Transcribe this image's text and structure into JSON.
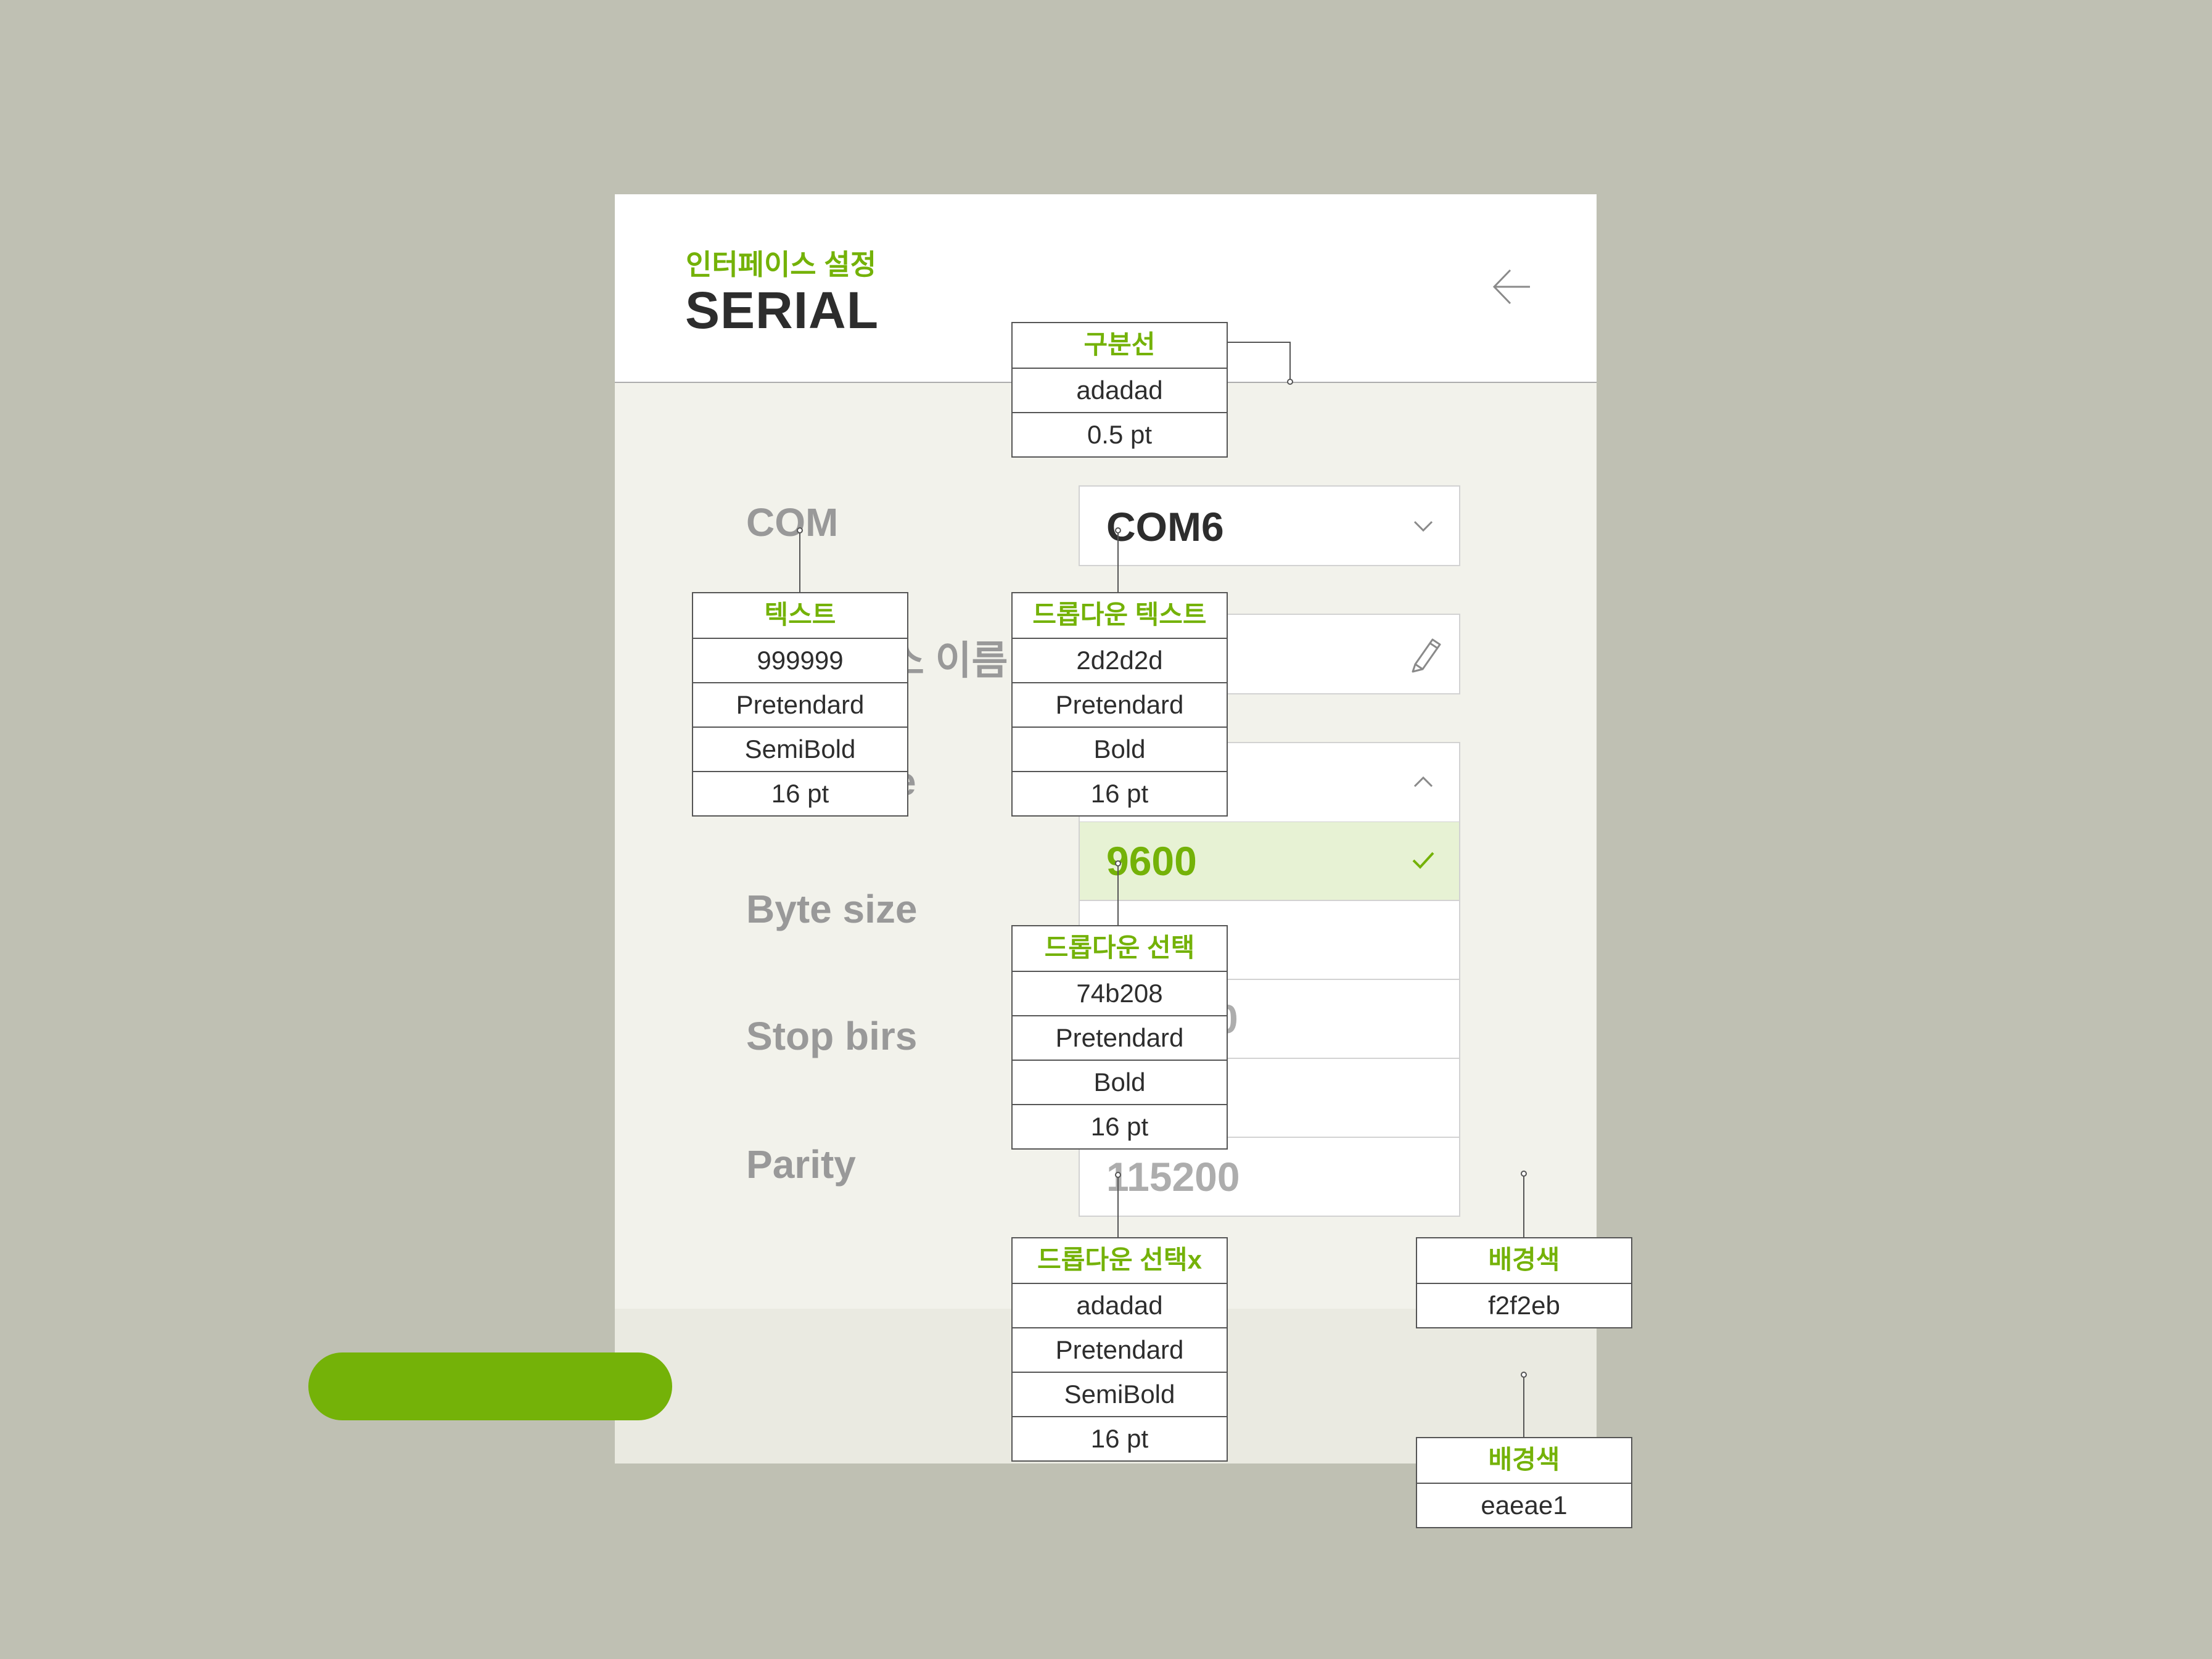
{
  "header": {
    "subtitle": "인터페이스 설정",
    "title": "SERIAL",
    "back_icon": "arrow-left-icon"
  },
  "form": {
    "rows": [
      {
        "label": "COM",
        "value": "COM6",
        "icon": "chevron-down-icon"
      },
      {
        "label": "소 이름",
        "icon": "pencil-icon"
      },
      {
        "label": "e",
        "icon": "chevron-up-icon"
      },
      {
        "label": "Byte size"
      },
      {
        "label": "Stop birs"
      },
      {
        "label": "Parity"
      }
    ],
    "dropdown_options": [
      {
        "text": "9600",
        "selected": true,
        "icon": "check-icon"
      },
      {
        "text": "",
        "selected": false
      },
      {
        "text": "0",
        "selected": false
      },
      {
        "text": "",
        "selected": false
      },
      {
        "text": "115200",
        "selected": false
      }
    ]
  },
  "annotations": {
    "divider": {
      "title": "구분선",
      "lines": [
        "adadad",
        "0.5 pt"
      ]
    },
    "text": {
      "title": "텍스트",
      "lines": [
        "999999",
        "Pretendard",
        "SemiBold",
        "16 pt"
      ]
    },
    "dropdown_text": {
      "title": "드롭다운 텍스트",
      "lines": [
        "2d2d2d",
        "Pretendard",
        "Bold",
        "16 pt"
      ]
    },
    "dropdown_selected": {
      "title": "드롭다운 선택",
      "lines": [
        "74b208",
        "Pretendard",
        "Bold",
        "16 pt"
      ]
    },
    "dropdown_unselected": {
      "title": "드롭다운 선택x",
      "lines": [
        "adadad",
        "Pretendard",
        "SemiBold",
        "16 pt"
      ]
    },
    "background_main": {
      "title": "배경색",
      "lines": [
        "f2f2eb"
      ]
    },
    "background_footer": {
      "title": "배경색",
      "lines": [
        "eaeae1"
      ]
    }
  },
  "colors": {
    "accent": "#74b208",
    "label_text": "#999999",
    "dropdown_text": "#2d2d2d",
    "divider": "#adadad",
    "bg_main": "#f2f2eb",
    "bg_footer": "#eaeae1",
    "page_bg": "#bfc0b3"
  }
}
